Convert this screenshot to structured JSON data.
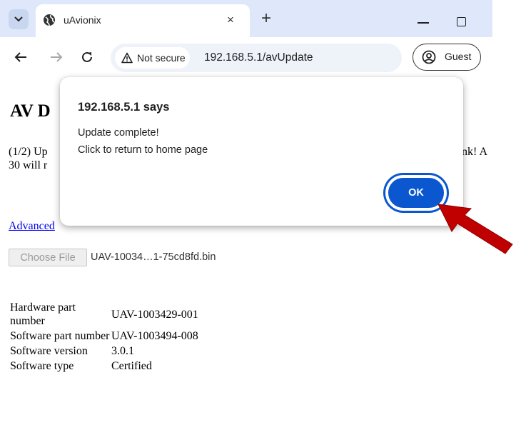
{
  "browser": {
    "tab_title": "uAvionix",
    "tab_close_glyph": "×",
    "new_tab_glyph": "+",
    "security_label": "Not secure",
    "url": "192.168.5.1/avUpdate",
    "profile_label": "Guest"
  },
  "page": {
    "heading": "AV D",
    "status_line1_left": "(1/2) Up",
    "status_line1_right": "nk! A",
    "status_line2": "30 will r",
    "advanced_link": "Advanced",
    "choose_file_label": "Choose File",
    "file_name": "UAV-10034…1-75cd8fd.bin",
    "info": [
      {
        "label": "Hardware part number",
        "value": "UAV-1003429-001"
      },
      {
        "label": "Software part number",
        "value": "UAV-1003494-008"
      },
      {
        "label": "Software version",
        "value": "3.0.1"
      },
      {
        "label": "Software type",
        "value": "Certified"
      }
    ]
  },
  "dialog": {
    "title": "192.168.5.1 says",
    "line1": "Update complete!",
    "line2": "Click to return to home page",
    "ok_label": "OK"
  },
  "colors": {
    "tabstrip": "#dfe8fa",
    "ok_button": "#0b57d0",
    "link": "#0000ee",
    "annotation_arrow": "#c00000"
  },
  "icons": [
    "tab-search-icon",
    "globe-icon",
    "close-icon",
    "new-tab-icon",
    "minimize-icon",
    "maximize-icon",
    "back-icon",
    "forward-icon",
    "reload-icon",
    "warning-icon",
    "profile-icon",
    "annotation-arrow-icon"
  ]
}
